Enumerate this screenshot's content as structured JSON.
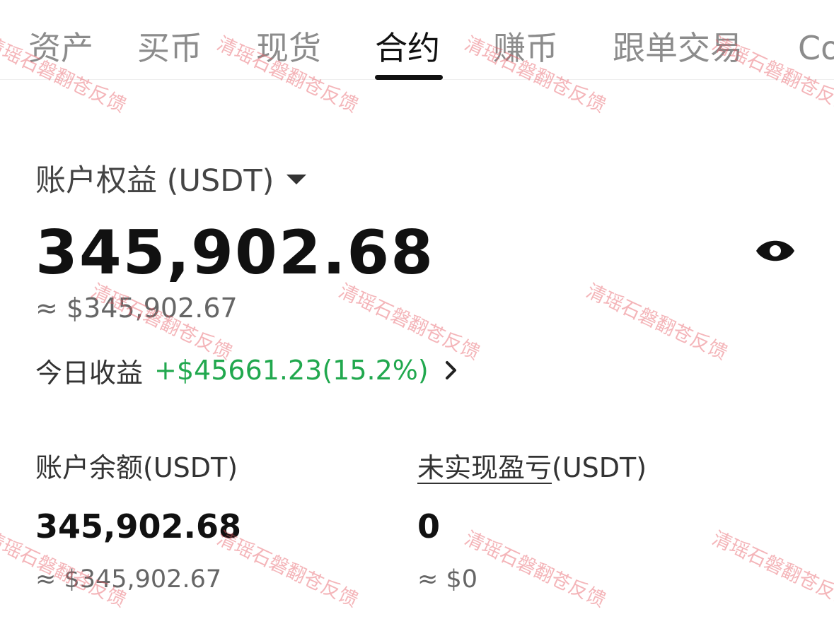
{
  "tabs": [
    {
      "label": "资产",
      "active": false
    },
    {
      "label": "买币",
      "active": false
    },
    {
      "label": "现货",
      "active": false
    },
    {
      "label": "合约",
      "active": true
    },
    {
      "label": "赚币",
      "active": false
    },
    {
      "label": "跟单交易",
      "active": false
    },
    {
      "label": "Co",
      "active": false
    }
  ],
  "equity": {
    "label": "账户权益 (USDT)",
    "value": "345,902.68",
    "approx": "≈ $345,902.67",
    "today_pnl_label": "今日收益",
    "today_pnl_value": "+$45661.23(15.2%)"
  },
  "balance": {
    "label": "账户余额(USDT)",
    "value": "345,902.68",
    "approx": "≈ $345,902.67"
  },
  "unrealized": {
    "label_link": "未实现盈亏",
    "label_suffix": "(USDT)",
    "value": "0",
    "approx": "≈ $0"
  },
  "watermark_text": "清瑶石磐翻苍反馈",
  "colors": {
    "positive": "#21a84e",
    "watermark": "#e65a64",
    "tab_inactive": "#8c8c8c",
    "tab_active": "#111111"
  },
  "icons": [
    "chevron-down-icon",
    "eye-icon",
    "chevron-right-icon"
  ]
}
